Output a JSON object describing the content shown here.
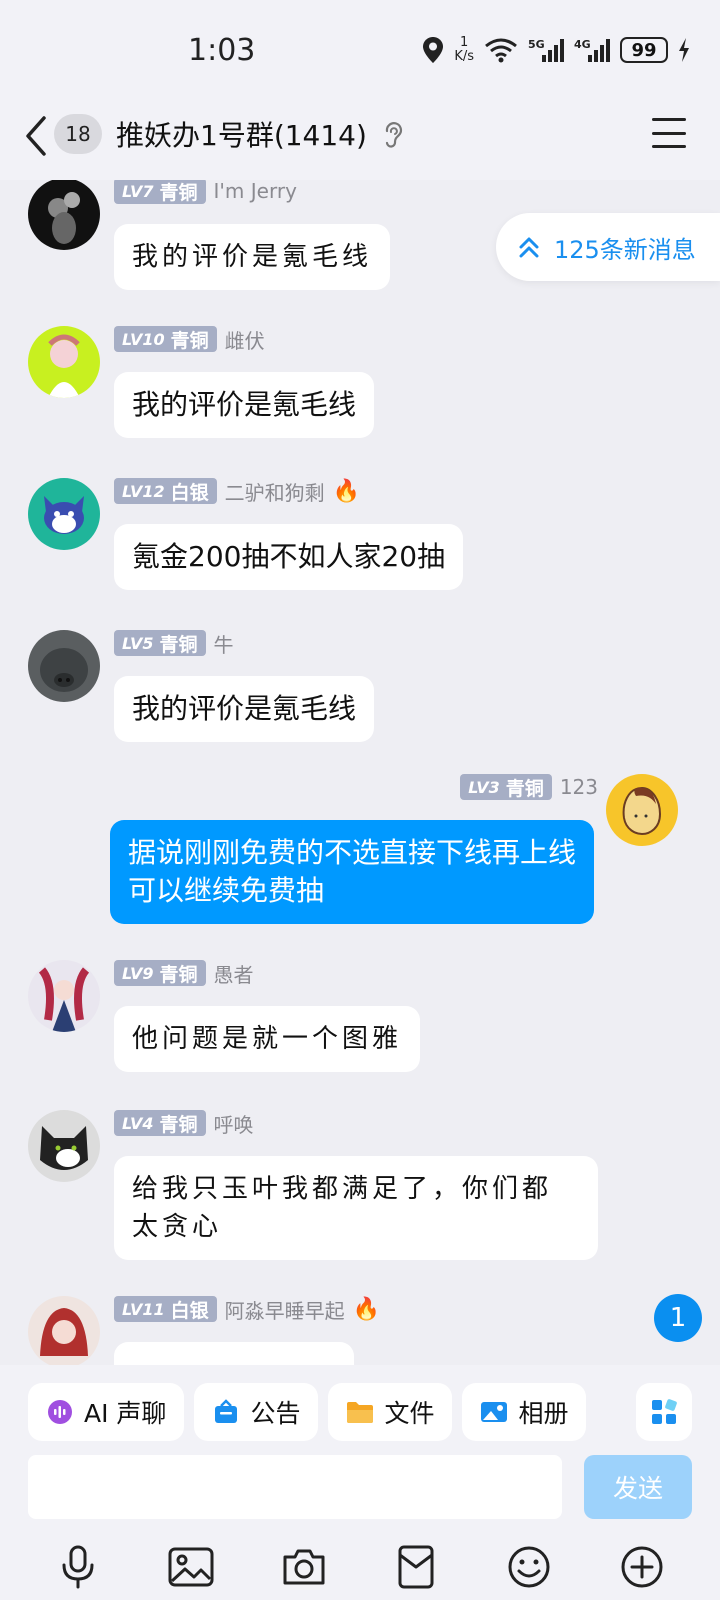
{
  "status_bar": {
    "time": "1:03",
    "net_speed_value": "1",
    "net_speed_unit": "K/s",
    "signal_5g": "5G",
    "signal_4g": "4G",
    "battery": "99"
  },
  "header": {
    "unread_count": "18",
    "title": "推妖办1号群(1414)"
  },
  "new_messages_pill": "125条新消息",
  "messages": [
    {
      "level": "LV7",
      "tier": "青铜",
      "nick": "I'm Jerry",
      "text": "我的评价是氪毛线"
    },
    {
      "level": "LV10",
      "tier": "青铜",
      "nick": "雌伏",
      "text": "我的评价是氪毛线"
    },
    {
      "level": "LV12",
      "tier": "白银",
      "nick": "二驴和狗剩",
      "text": "氪金200抽不如人家20抽"
    },
    {
      "level": "LV5",
      "tier": "青铜",
      "nick": "牛",
      "text": "我的评价是氪毛线"
    },
    {
      "level": "LV3",
      "tier": "青铜",
      "nick": "123",
      "text": "据说刚刚免费的不选直接下线再上线可以继续免费抽"
    },
    {
      "level": "LV9",
      "tier": "青铜",
      "nick": "愚者",
      "text": "他问题是就一个图雅"
    },
    {
      "level": "LV4",
      "tier": "青铜",
      "nick": "呼唤",
      "text": "给我只玉叶我都满足了，你们都太贪心"
    },
    {
      "level": "LV11",
      "tier": "白银",
      "nick": "阿淼早睡早起",
      "text": ""
    }
  ],
  "floating_unread": "1",
  "quick_actions": [
    {
      "label": "AI 声聊",
      "icon": "ai-voice-icon",
      "color": "#a04fe0"
    },
    {
      "label": "公告",
      "icon": "announcement-icon",
      "color": "#1a8fef"
    },
    {
      "label": "文件",
      "icon": "folder-icon",
      "color": "#f5a623"
    },
    {
      "label": "相册",
      "icon": "album-icon",
      "color": "#1a8fef"
    }
  ],
  "composer": {
    "input_value": "",
    "send_label": "发送"
  },
  "colors": {
    "accent": "#0099ff",
    "self_bubble": "#0099ff",
    "send_disabled": "#9dd2fb",
    "level_badge": "#a6aec5"
  }
}
